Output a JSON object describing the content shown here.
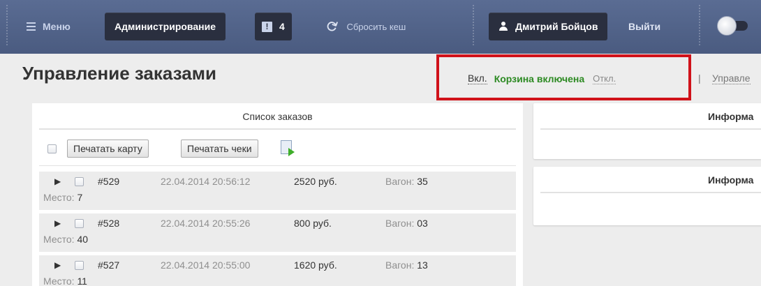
{
  "topbar": {
    "menu_label": "Меню",
    "admin_label": "Администрирование",
    "notifications_count": "4",
    "reset_cache_label": "Сбросить кеш",
    "user_name": "Дмитрий Бойцов",
    "logout_label": "Выйти",
    "icons": {
      "menu": "hamburger-icon",
      "notifications": "flag-icon",
      "reset": "refresh-icon",
      "user": "user-icon",
      "toggle": "toggle-switch"
    }
  },
  "page": {
    "title": "Управление заказами"
  },
  "cart": {
    "on_link": "Вкл.",
    "status": "Корзина включена",
    "off_link": "Откл.",
    "separator": "|",
    "manage_link": "Управле"
  },
  "orders_panel": {
    "title": "Список заказов",
    "print_map_label": "Печатать карту",
    "print_checks_label": "Печатать чеки",
    "export_icon": "excel-export-icon",
    "seat_label": "Место:",
    "wagon_label": "Вагон:",
    "rows": [
      {
        "number": "#529",
        "datetime": "22.04.2014 20:56:12",
        "price": "2520 руб.",
        "wagon": "35",
        "seat": "7"
      },
      {
        "number": "#528",
        "datetime": "22.04.2014 20:55:26",
        "price": "800 руб.",
        "wagon": "03",
        "seat": "40"
      },
      {
        "number": "#527",
        "datetime": "22.04.2014 20:55:00",
        "price": "1620 руб.",
        "wagon": "13",
        "seat": "11"
      }
    ]
  },
  "info_panels": [
    {
      "title": "Информа"
    },
    {
      "title": "Информа"
    }
  ],
  "colors": {
    "topbar": "#4f6088",
    "highlight_border": "#d0121a",
    "cart_on": "#2c8a22"
  }
}
